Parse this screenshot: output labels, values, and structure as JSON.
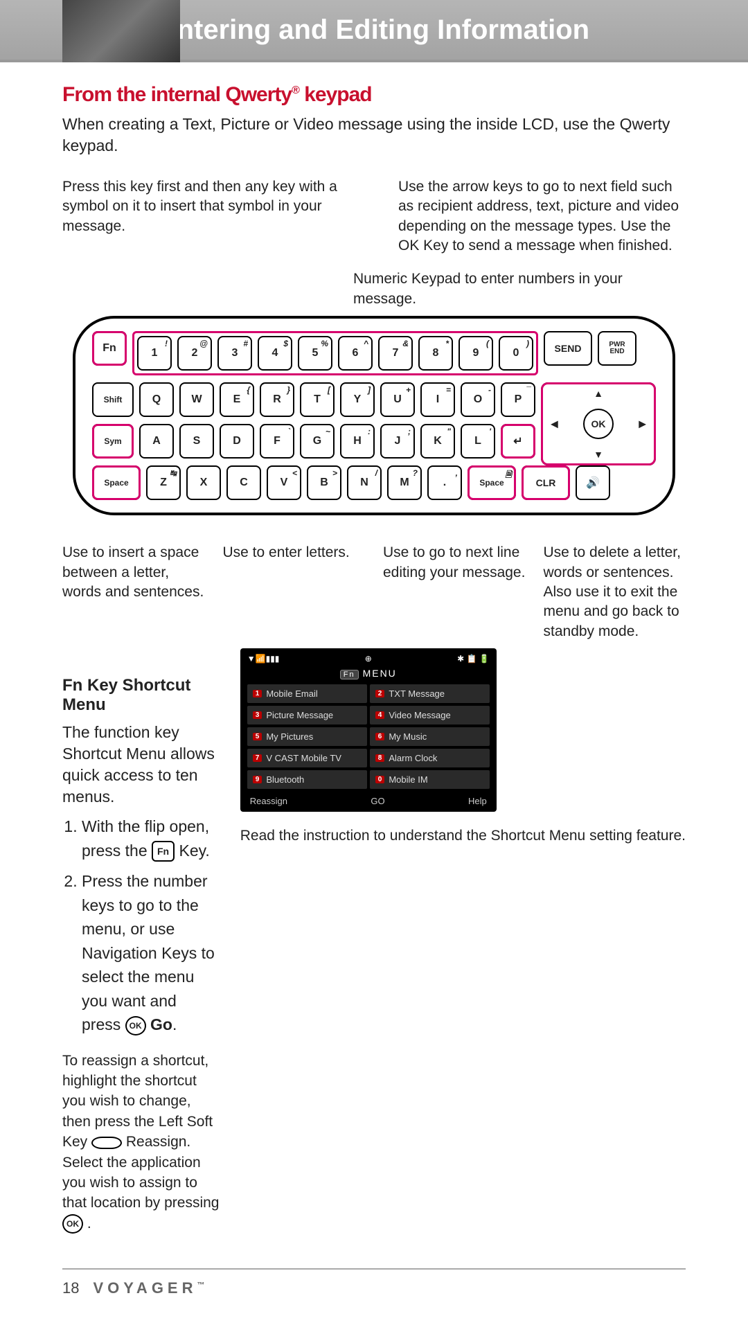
{
  "banner_title": "Entering and Editing Information",
  "section_title": "From the internal Qwerty",
  "section_title_sup": "®",
  "section_title_tail": " keypad",
  "intro": "When creating a Text, Picture or Video message using the inside LCD, use the Qwerty keypad.",
  "callouts": {
    "fn": "Press this key first and then any key with a symbol on it to insert that symbol in your message.",
    "arrows": "Use the arrow keys to go to next field such as recipient address, text, picture and video depending on the message types. Use the OK Key to send a message when finished.",
    "numeric": "Numeric Keypad to enter numbers in your message.",
    "space": "Use to insert a space between a letter, words and sentences.",
    "letters": "Use to enter letters.",
    "enter": "Use to go to next line editing your message.",
    "clr": "Use to delete a letter, words or sentences. Also use it to exit the menu and go back to standby mode."
  },
  "kbd": {
    "row1": [
      {
        "k": "Fn",
        "sym": ""
      },
      {
        "k": "1",
        "sym": "!"
      },
      {
        "k": "2",
        "sym": "@"
      },
      {
        "k": "3",
        "sym": "#"
      },
      {
        "k": "4",
        "sym": "$"
      },
      {
        "k": "5",
        "sym": "%"
      },
      {
        "k": "6",
        "sym": "^"
      },
      {
        "k": "7",
        "sym": "&"
      },
      {
        "k": "8",
        "sym": "*"
      },
      {
        "k": "9",
        "sym": "("
      },
      {
        "k": "0",
        "sym": ")"
      },
      {
        "k": "SEND",
        "sym": ""
      },
      {
        "k": "PWR",
        "k2": "END"
      }
    ],
    "row2": [
      {
        "k": "Shift"
      },
      {
        "k": "Q"
      },
      {
        "k": "W"
      },
      {
        "k": "E",
        "sym": "{"
      },
      {
        "k": "R",
        "sym": "}"
      },
      {
        "k": "T",
        "sym": "["
      },
      {
        "k": "Y",
        "sym": "]"
      },
      {
        "k": "U",
        "sym": "+"
      },
      {
        "k": "I",
        "sym": "="
      },
      {
        "k": "O",
        "sym": "-"
      },
      {
        "k": "P",
        "sym": "¯"
      }
    ],
    "row3": [
      {
        "k": "Sym"
      },
      {
        "k": "A"
      },
      {
        "k": "S"
      },
      {
        "k": "D"
      },
      {
        "k": "F",
        "sym": "`"
      },
      {
        "k": "G",
        "sym": "~"
      },
      {
        "k": "H",
        "sym": ":"
      },
      {
        "k": "J",
        "sym": ";"
      },
      {
        "k": "K",
        "sym": "\""
      },
      {
        "k": "L",
        "sym": "'"
      },
      {
        "k": "↵"
      }
    ],
    "row4": [
      {
        "k": "Space"
      },
      {
        "k": "Z",
        "sym": "↹"
      },
      {
        "k": "X"
      },
      {
        "k": "C"
      },
      {
        "k": "V",
        "sym": "<"
      },
      {
        "k": "B",
        "sym": ">"
      },
      {
        "k": "N",
        "sym": "/"
      },
      {
        "k": "M",
        "sym": "?"
      },
      {
        "k": ".",
        "sym": ","
      },
      {
        "k": "Space",
        "sym": "🗎"
      },
      {
        "k": "CLR"
      },
      {
        "k": "🔊"
      }
    ],
    "ok": "OK"
  },
  "fnshortcut": {
    "title": "Fn Key Shortcut Menu",
    "desc": "The function key Shortcut Menu allows quick access to ten menus.",
    "step1a": "With the flip open, press the ",
    "step1_key": "Fn",
    "step1b": " Key.",
    "step2": "Press the number keys to go to the menu, or use Navigation Keys to select the menu you want and press ",
    "step2_go": "Go",
    "step2_tail": "."
  },
  "screen": {
    "status_left": "▼📶▮▮▮",
    "status_mid": "⊕",
    "status_right": "✱ 📋 🔋",
    "head_fn": "Fn",
    "head_label": "MENU",
    "items": [
      {
        "n": "1",
        "t": "Mobile Email"
      },
      {
        "n": "2",
        "t": "TXT Message"
      },
      {
        "n": "3",
        "t": "Picture Message"
      },
      {
        "n": "4",
        "t": "Video Message"
      },
      {
        "n": "5",
        "t": "My Pictures"
      },
      {
        "n": "6",
        "t": "My Music"
      },
      {
        "n": "7",
        "t": "V CAST Mobile TV"
      },
      {
        "n": "8",
        "t": "Alarm Clock"
      },
      {
        "n": "9",
        "t": "Bluetooth"
      },
      {
        "n": "0",
        "t": "Mobile IM"
      }
    ],
    "soft_left": "Reassign",
    "soft_mid": "GO",
    "soft_right": "Help"
  },
  "footnote1a": "To reassign a shortcut, highlight the shortcut you wish to change, then press the Left Soft Key ",
  "footnote1b": " Reassign. Select the application you wish to assign to that location by pressing ",
  "footnote1c": " .",
  "readnote": "Read the instruction to understand the Shortcut Menu setting feature.",
  "page_number": "18",
  "brand": "VOYAGER",
  "brand_tm": "™"
}
